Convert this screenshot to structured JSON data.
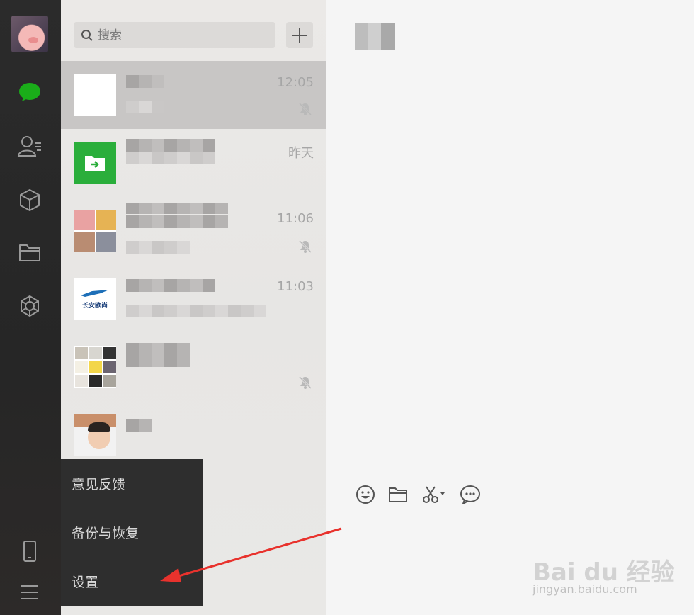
{
  "navbar": {
    "icons": [
      "chat-icon",
      "contacts-icon",
      "box-icon",
      "folder-icon",
      "moments-icon",
      "phone-icon",
      "menu-icon"
    ],
    "active_color": "#1aad19"
  },
  "search": {
    "placeholder": "搜索"
  },
  "chats": [
    {
      "time": "12:05",
      "muted": true
    },
    {
      "time": "昨天",
      "muted": false
    },
    {
      "time": "11:06",
      "muted": true
    },
    {
      "time": "11:03",
      "muted": false,
      "avatar_text": "长安欧尚"
    },
    {
      "time": "",
      "muted": true
    },
    {
      "time": "",
      "muted": false
    }
  ],
  "popup_menu": {
    "items": [
      "意见反馈",
      "备份与恢复",
      "设置"
    ]
  },
  "toolbar": [
    "emoji-icon",
    "folder-icon",
    "scissors-icon",
    "chat-bubble-icon"
  ],
  "watermark": {
    "logo": "Bai du 经验",
    "sub": "jingyan.baidu.com"
  },
  "colors": {
    "accent": "#1aad19",
    "arrow": "#e8322d"
  }
}
